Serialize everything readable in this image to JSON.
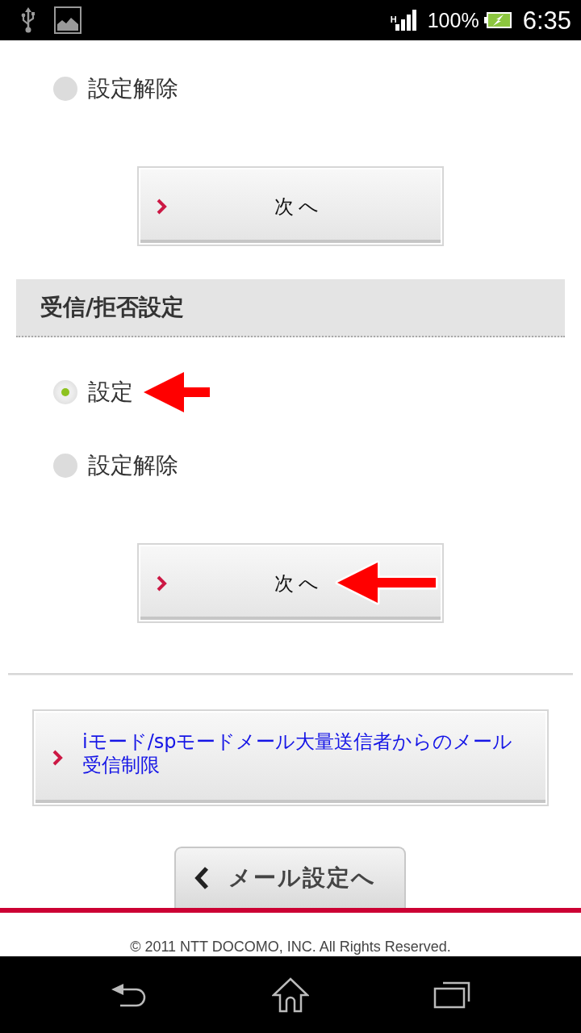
{
  "status_bar": {
    "network": "H",
    "battery": "100%",
    "time": "6:35"
  },
  "section_1": {
    "options": [
      {
        "label": "設定解除",
        "selected": false,
        "pointer_arrow": false
      }
    ],
    "next_button": {
      "label": "次へ",
      "pointer_arrow": false
    }
  },
  "section_2": {
    "title": "受信/拒否設定",
    "options": [
      {
        "label": "設定",
        "selected": true,
        "pointer_arrow": true
      },
      {
        "label": "設定解除",
        "selected": false,
        "pointer_arrow": false
      }
    ],
    "next_button": {
      "label": "次へ",
      "pointer_arrow": true
    }
  },
  "link_button": {
    "label": "iモード/spモードメール大量送信者からのメール受信制限"
  },
  "back_button": {
    "label": "メール設定へ"
  },
  "footer": {
    "copyright": "© 2011 NTT DOCOMO, INC. All Rights Reserved."
  }
}
